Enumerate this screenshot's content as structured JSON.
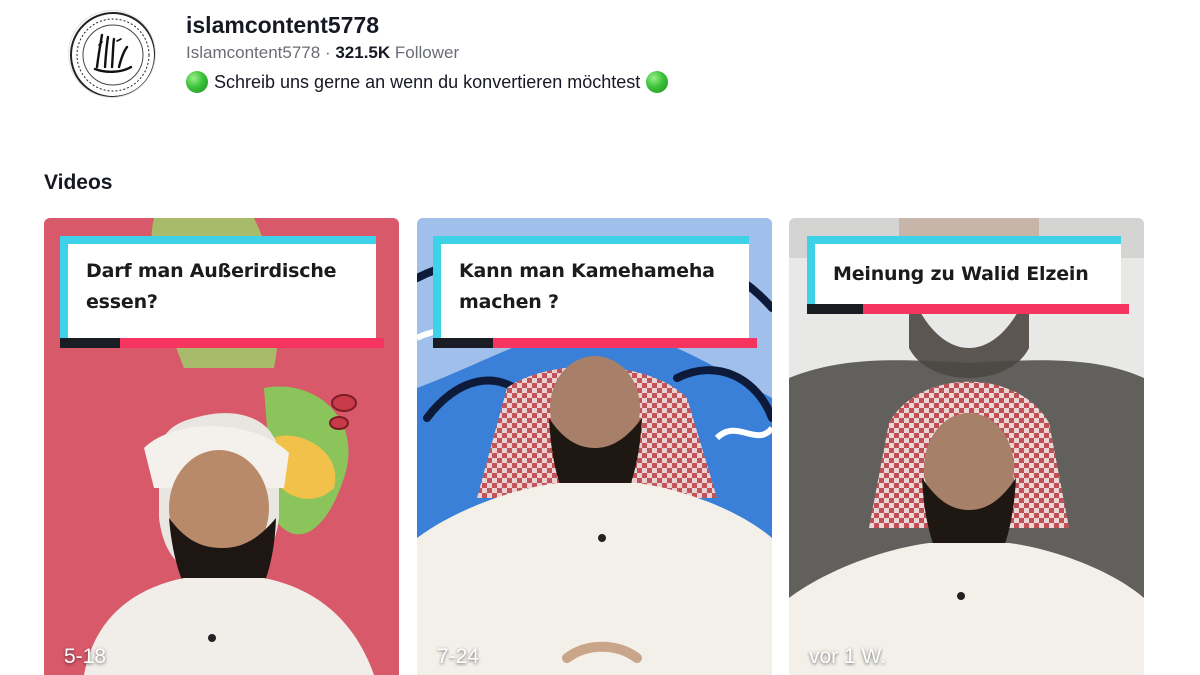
{
  "profile": {
    "username": "islamcontent5778",
    "handle": "Islamcontent5778",
    "separator": "·",
    "follower_count": "321.5K",
    "follower_label": "Follower",
    "bio": "Schreib uns gerne an wenn du konvertieren möchtest",
    "avatar_icon": "allah-calligraphy-icon",
    "bio_emoji": "green-circle-icon"
  },
  "section": {
    "title": "Videos"
  },
  "videos": [
    {
      "caption": "Darf man Außerirdische essen?",
      "timestamp": "5-18",
      "background": "#d8596a"
    },
    {
      "caption": "Kann man Kamehameha machen ?",
      "timestamp": "7-24",
      "background": "#3a7fd8"
    },
    {
      "caption": "Meinung zu Walid Elzein",
      "timestamp": "vor 1 W.",
      "background": "#e8e8e6"
    }
  ],
  "colors": {
    "caption_cyan": "#3ed2e8",
    "caption_red": "#f5345f",
    "caption_dark": "#1b1d24",
    "text_primary": "#161823",
    "text_secondary": "#6b6d75"
  }
}
